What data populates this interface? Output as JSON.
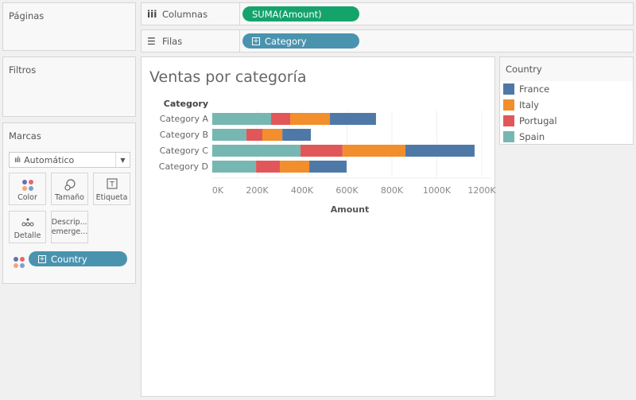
{
  "panels": {
    "paginas": "Páginas",
    "filtros": "Filtros",
    "marcas": "Marcas"
  },
  "shelves": {
    "columns_label": "Columnas",
    "columns_icon": "columns-icon",
    "columns_pill": "SUMA(Amount)",
    "rows_label": "Filas",
    "rows_icon": "rows-icon",
    "rows_pill": "Category"
  },
  "marks": {
    "mark_type": "Automático",
    "buttons": [
      {
        "label": "Color",
        "icon": "color-dots-icon"
      },
      {
        "label": "Tamaño",
        "icon": "size-icon"
      },
      {
        "label": "Etiqueta",
        "icon": "label-icon"
      },
      {
        "label": "Detalle",
        "icon": "detail-icon"
      },
      {
        "label": "Descrip... emerge...",
        "icon": "tooltip"
      }
    ],
    "color_pill": "Country"
  },
  "colors": {
    "France": "#4e79a7",
    "Italy": "#f28e2b",
    "Portugal": "#e15759",
    "Spain": "#76b7b2"
  },
  "legend": {
    "title": "Country",
    "items": [
      "France",
      "Italy",
      "Portugal",
      "Spain"
    ]
  },
  "chart_data": {
    "type": "bar",
    "orientation": "horizontal",
    "stacked": true,
    "title": "Ventas por categoría",
    "ylabel": "Category",
    "xlabel": "Amount",
    "categories": [
      "Category A",
      "Category B",
      "Category C",
      "Category D"
    ],
    "series": [
      {
        "name": "Spain",
        "values": [
          262000,
          152000,
          393000,
          195000
        ]
      },
      {
        "name": "Portugal",
        "values": [
          85000,
          71000,
          187000,
          106000
        ]
      },
      {
        "name": "Italy",
        "values": [
          177000,
          89000,
          280000,
          131000
        ]
      },
      {
        "name": "France",
        "values": [
          205000,
          127000,
          308000,
          166000
        ]
      }
    ],
    "xlim": [
      0,
      1250000
    ],
    "xticks": [
      0,
      200000,
      400000,
      600000,
      800000,
      1000000,
      1200000
    ],
    "xtick_labels": [
      "0K",
      "200K",
      "400K",
      "600K",
      "800K",
      "1000K",
      "1200K"
    ],
    "grid": true,
    "legend_position": "right"
  }
}
